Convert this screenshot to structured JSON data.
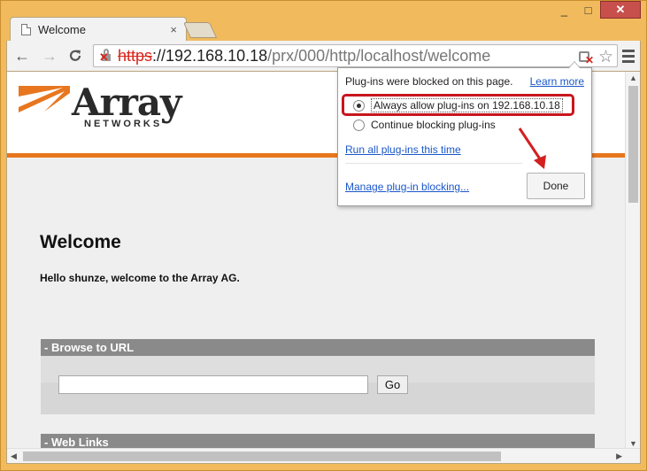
{
  "window": {
    "controls": {
      "minimize": "_",
      "maximize": "□",
      "close": "✕"
    }
  },
  "tab": {
    "title": "Welcome",
    "close": "×"
  },
  "toolbar": {
    "back": "←",
    "forward": "→",
    "reload": "C",
    "url_scheme": "https",
    "url_host": "://192.168.10.18",
    "url_path": "/prx/000/http/localhost/welcome",
    "star": "☆"
  },
  "page": {
    "brand_name": "Array",
    "brand_sub": "NETWORKS",
    "brand_color": "#e8761e",
    "welcome_title": "Welcome",
    "welcome_message": "Hello shunze, welcome to the Array AG.",
    "browse_section": "- Browse to URL",
    "go_label": "Go",
    "weblinks_section": "- Web Links"
  },
  "popup": {
    "message": "Plug-ins were blocked on this page.",
    "learn_more": "Learn more",
    "option_allow": "Always allow plug-ins on 192.168.10.18",
    "option_block": "Continue blocking plug-ins",
    "selected_option": "option_allow",
    "run_all": "Run all plug-ins this time",
    "manage": "Manage plug-in blocking...",
    "done": "Done",
    "highlight_color": "#c8161d"
  }
}
